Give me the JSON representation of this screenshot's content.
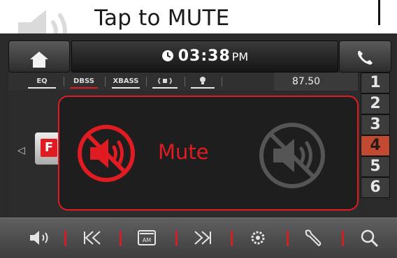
{
  "caption": {
    "text": "Tap to MUTE"
  },
  "topbar": {
    "time": "03:38",
    "ampm": "PM"
  },
  "audio_tabs": [
    "EQ",
    "DBSS",
    "XBASS",
    "",
    ""
  ],
  "frequency": "87.50",
  "presets": [
    "1",
    "2",
    "3",
    "4",
    "5",
    "6"
  ],
  "active_preset": "4",
  "source_logo": "F",
  "popup": {
    "mute_label": "Mute"
  },
  "colors": {
    "accent": "#e11b22",
    "active_preset": "#c24a33",
    "frame": "#2a2a2a"
  },
  "toolbar_icons": [
    "speaker-icon",
    "skip-back-icon",
    "am-icon",
    "skip-forward-icon",
    "gear-icon",
    "wrench-icon",
    "search-icon"
  ],
  "toolbar": {
    "am_label": "AM"
  }
}
